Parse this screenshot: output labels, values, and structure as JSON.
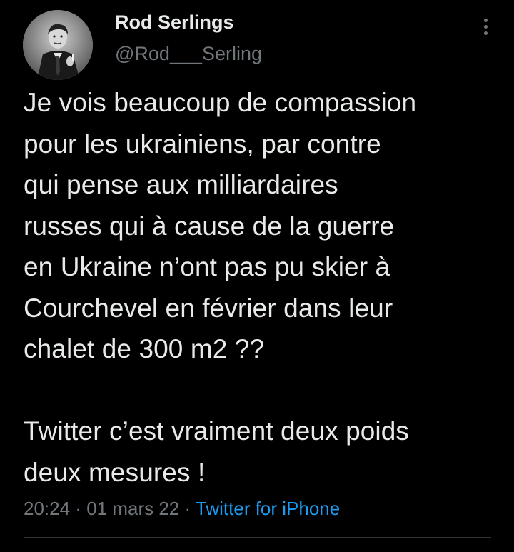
{
  "user": {
    "display_name": "Rod Serlings",
    "handle": "@Rod___Serling",
    "avatar_icon": "profile-avatar"
  },
  "tweet": {
    "text": "Je vois beaucoup de compassion\npour les ukrainiens, par contre\nqui pense aux milliardaires\nrusses qui à cause de la guerre\nen Ukraine  n’ont pas pu skier à\nCourchevel en février dans leur\nchalet de 300 m2 ??\n\nTwitter c’est vraiment deux poids\ndeux mesures !",
    "time": "20:24",
    "separator": " · ",
    "date": "01 mars 22",
    "source": "Twitter for iPhone"
  },
  "colors": {
    "background": "#000000",
    "primary_text": "#e7e9ea",
    "secondary_text": "#71767b",
    "accent": "#1d9bf0",
    "divider": "#2f3336"
  },
  "menu": {
    "icon": "more-vertical-icon"
  }
}
